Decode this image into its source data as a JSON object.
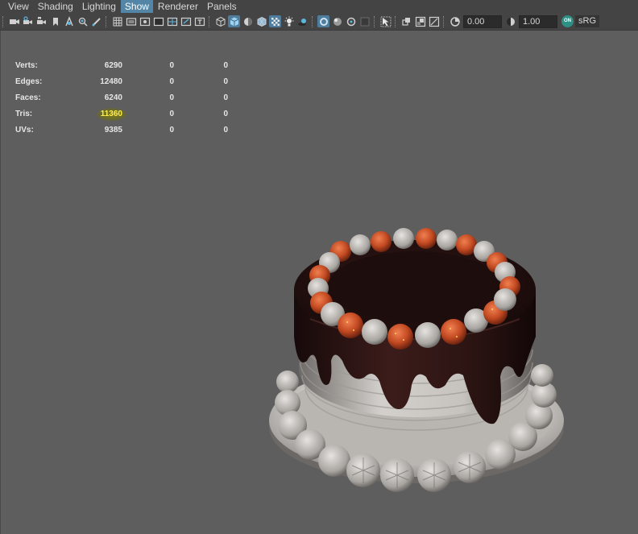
{
  "menubar": {
    "items": [
      {
        "label": "View"
      },
      {
        "label": "Shading"
      },
      {
        "label": "Lighting"
      },
      {
        "label": "Show",
        "active": true
      },
      {
        "label": "Renderer"
      },
      {
        "label": "Panels"
      }
    ]
  },
  "toolbar": {
    "exposure_value": "0.00",
    "gamma_value": "1.00",
    "color_mgmt_badge": "ON",
    "color_space": "sRG"
  },
  "hud": {
    "rows": [
      {
        "label": "Verts:",
        "c1": "6290",
        "c2": "0",
        "c3": "0"
      },
      {
        "label": "Edges:",
        "c1": "12480",
        "c2": "0",
        "c3": "0"
      },
      {
        "label": "Faces:",
        "c1": "6240",
        "c2": "0",
        "c3": "0"
      },
      {
        "label": "Tris:",
        "c1": "11360",
        "c2": "0",
        "c3": "0",
        "highlight": true
      },
      {
        "label": "UVs:",
        "c1": "9385",
        "c2": "0",
        "c3": "0"
      }
    ],
    "highlight_color": "#ffef4a"
  },
  "colors": {
    "viewport_bg": "#5e5e5e",
    "menubar_bg": "#444444",
    "active_menu": "#5285a6",
    "chocolate": "#2a1414",
    "frosting": "#bdbab6",
    "strawberry": "#c7532a"
  }
}
